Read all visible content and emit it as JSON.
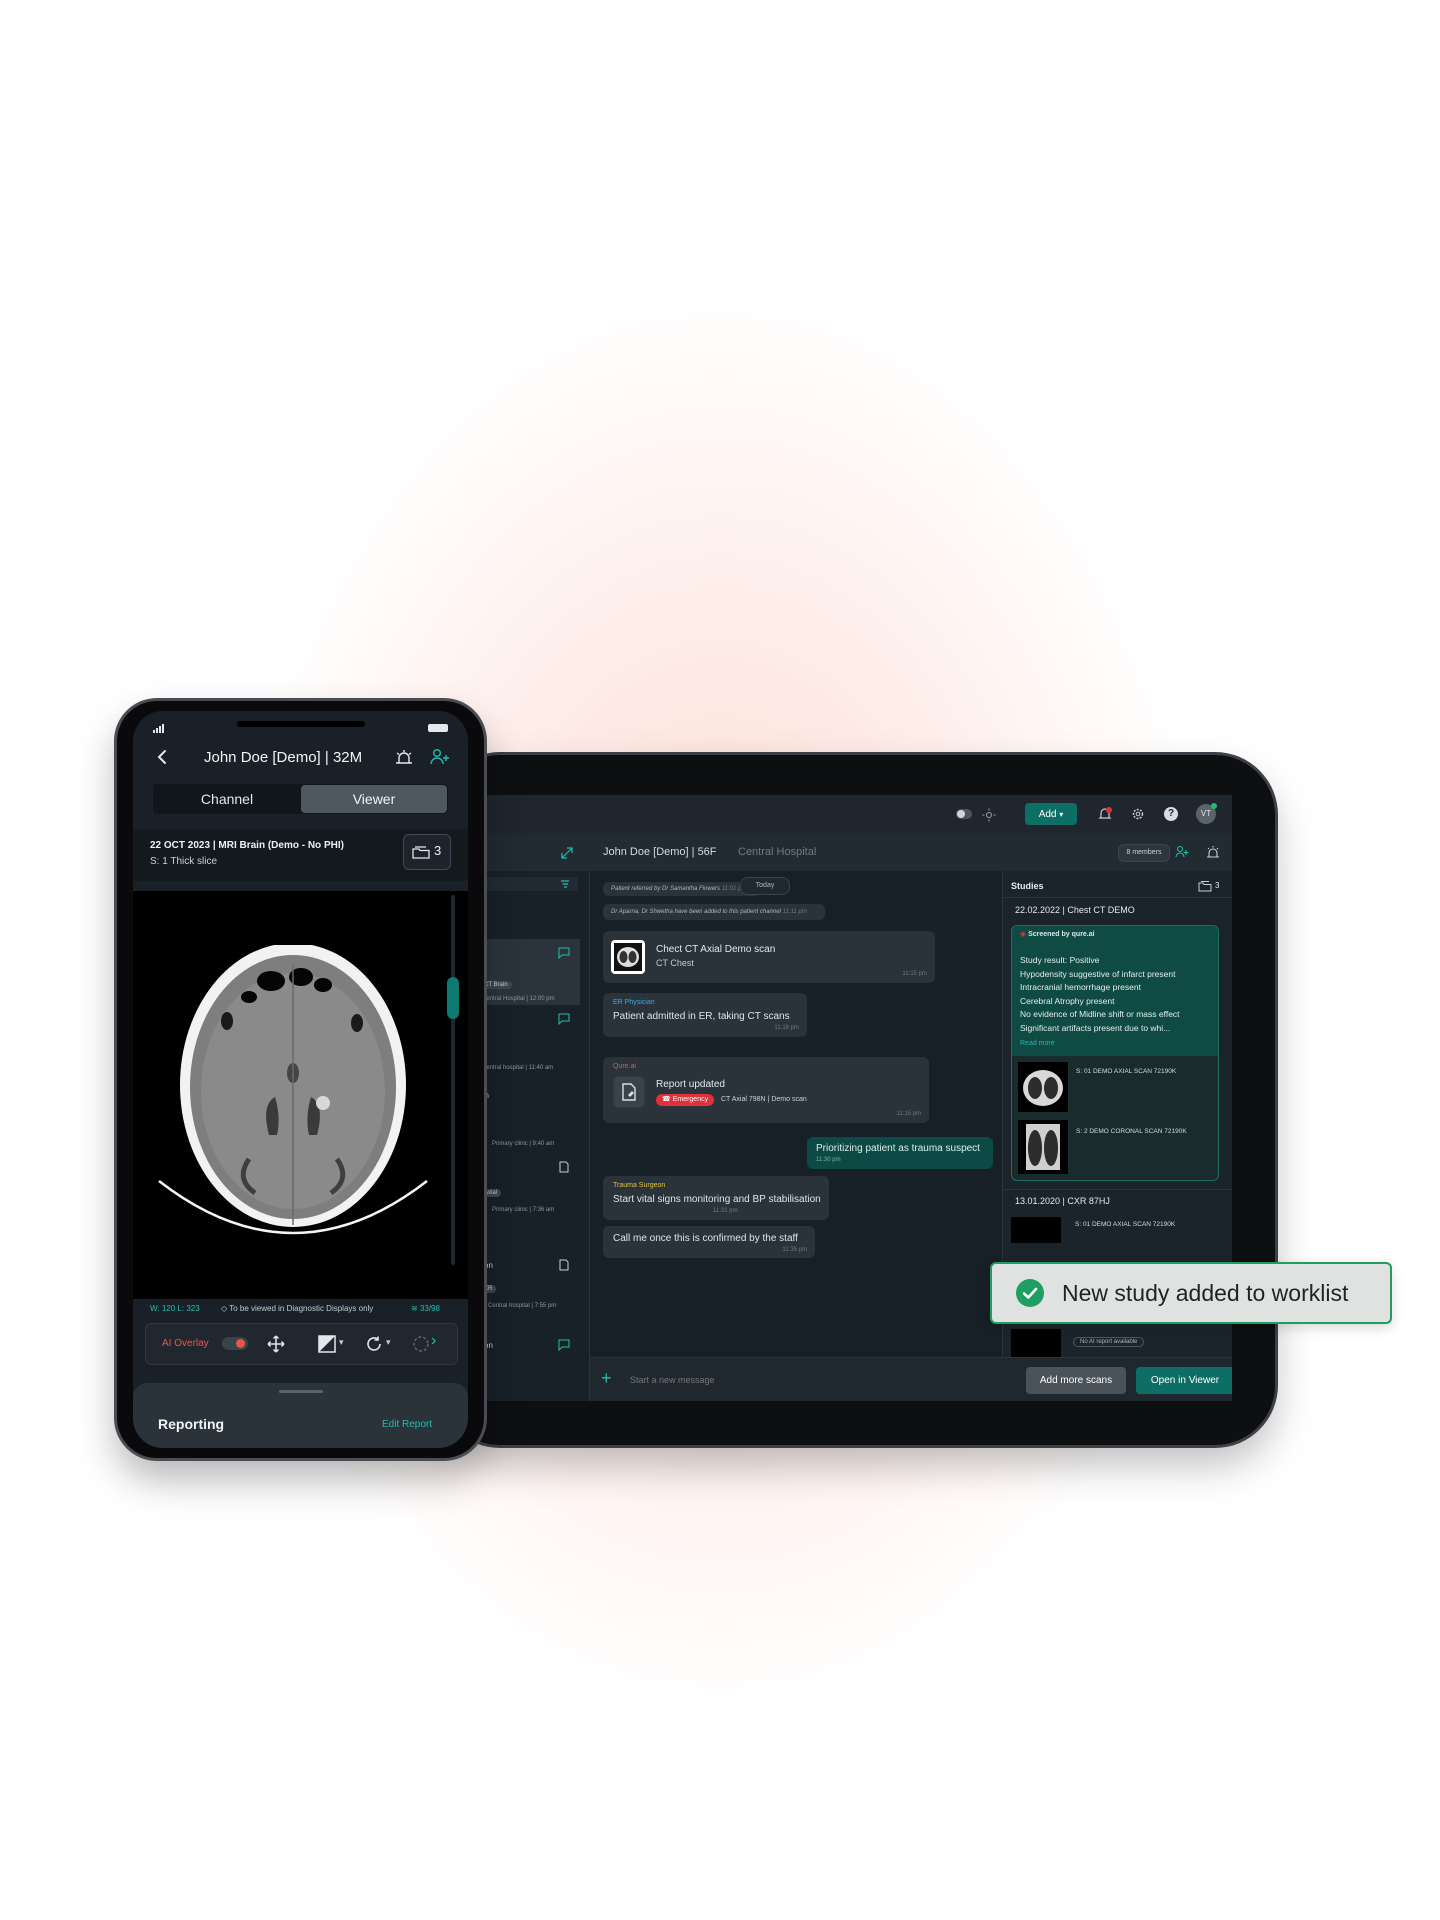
{
  "phone": {
    "title": "John Doe [Demo] | 32M",
    "tabs": [
      {
        "label": "Channel"
      },
      {
        "label": "Viewer"
      }
    ],
    "study": {
      "date_title": "22 OCT 2023 | MRI Brain (Demo - No PHI)",
      "series": "S: 1 Thick slice",
      "count": "3"
    },
    "viewer_footer": {
      "wl": "W: 120 L: 323",
      "notice": "To be viewed in Diagnostic Displays only",
      "slices": "33/98"
    },
    "toolbar": {
      "ai_overlay": "AI Overlay"
    },
    "reporting": {
      "title": "Reporting",
      "edit": "Edit Report"
    }
  },
  "tablet": {
    "header": {
      "add_label": "Add",
      "avatar": "VT"
    },
    "subheader": {
      "patient": "John Doe [Demo] | 56F",
      "hospital": "Central Hospital",
      "members": "8 members"
    },
    "left_list": [
      {
        "tag": "CT Brain",
        "time": "Central Hospital | 12:00 pm"
      },
      {
        "time": "Central hospital | 11:40 am"
      },
      {
        "name": "on",
        "time": "Primary clinic | 9:40 am"
      },
      {
        "tag": "Axial",
        "time": "Primary clinic | 7:36 am"
      },
      {
        "name": "son",
        "tag": "XR",
        "time": "Central hospital | 7:55 pm"
      },
      {
        "name": "son"
      }
    ],
    "chat": {
      "today": "Today",
      "system1": "Patient referred by Dr Samantha Flowers",
      "system1_time": "11:01 pm",
      "system2": "Dr Aparna, Dr Shwetha have been added to this patient channel",
      "system2_time": "11:11 pm",
      "scan_card": {
        "title": "Chect CT Axial Demo scan",
        "sub": "CT Chest",
        "time": "11:15 pm"
      },
      "er": {
        "role": "ER Physician",
        "text": "Patient admitted in ER, taking CT scans",
        "time": "11:16 pm"
      },
      "report": {
        "role": "Qure.ai",
        "title": "Report updated",
        "badge": "Emergency",
        "sub": "CT Axial 798N | Demo scan",
        "time": "11:15 pm"
      },
      "own": {
        "text": "Prioritizing patient as trauma suspect",
        "time": "11:30 pm"
      },
      "trauma": {
        "role": "Trauma Surgeon",
        "text": "Start vital signs monitoring and BP stabilisation",
        "time": "11:31 pm"
      },
      "call": {
        "text": "Call me once this is confirmed by the staff",
        "time": "11:35 pm"
      },
      "input_placeholder": "Start a new message",
      "add_scans": "Add more scans",
      "open_viewer": "Open in Viewer"
    },
    "studies": {
      "title": "Studies",
      "count": "3",
      "s1": {
        "title": "22.02.2022 | Chest CT DEMO",
        "screened": "Screened by qure.ai",
        "findings": [
          "Study result: Positive",
          "Hypodensity suggestive of infarct present",
          "Intracranial hemorrhage present",
          "Cerebral Atrophy present",
          "No evidence of Midline shift or mass effect",
          "Significant artifacts present due to whi..."
        ],
        "read_more": "Read more",
        "scans": [
          {
            "label": "S: 01 DEMO AXIAL SCAN 72190K"
          },
          {
            "label": "S: 2 DEMO CORONAL SCAN 72190K"
          }
        ]
      },
      "s2": {
        "title": "13.01.2020 | CXR 87HJ",
        "scan": "S: 01 DEMO AXIAL SCAN 72190K",
        "no_ai": "No AI report available"
      }
    }
  },
  "toast": {
    "text": "New study added to worklist"
  },
  "colors": {
    "teal": "#0d6e66",
    "accent": "#1fbfae",
    "emergency": "#e0313a",
    "toast_border": "#1e9e61",
    "bg_glow": "#fbd9d2"
  }
}
